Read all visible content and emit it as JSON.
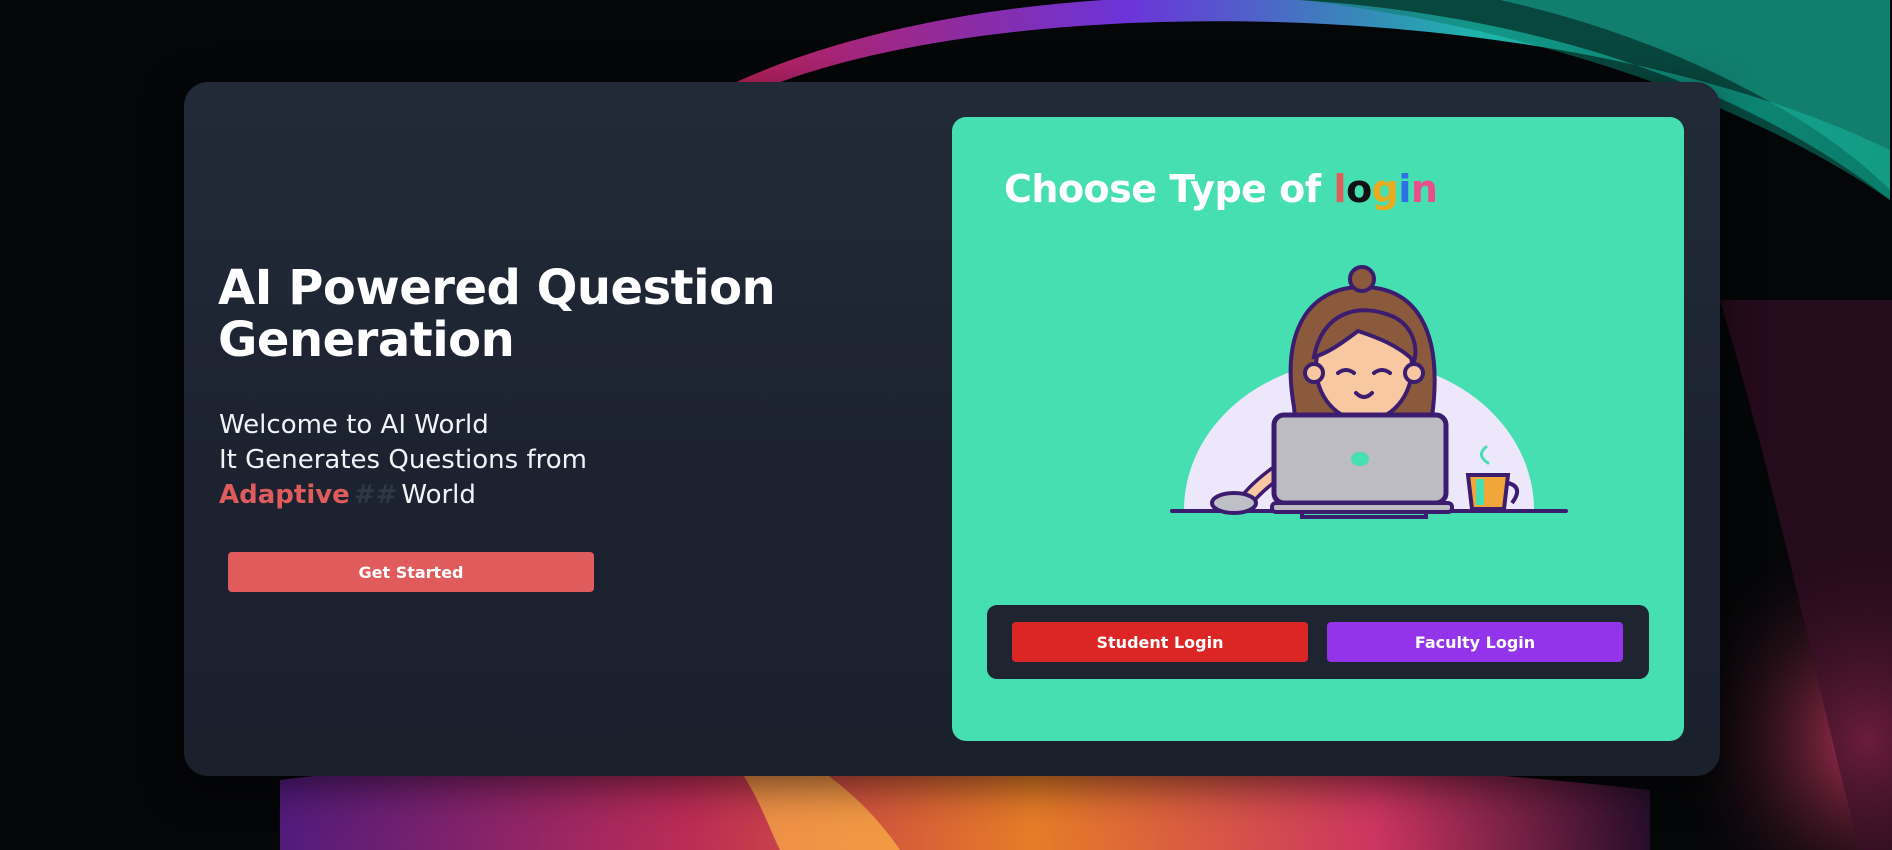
{
  "hero": {
    "title_line1": "AI Powered Question",
    "title_line2": "Generation",
    "welcome_line1": "Welcome to AI World",
    "welcome_line2": "It Generates Questions from",
    "welcome_adaptive": "Adaptive",
    "welcome_cursor": "##",
    "welcome_world": "World",
    "get_started_label": "Get Started"
  },
  "login": {
    "title_prefix": "Choose Type of ",
    "title_letters": [
      "l",
      "o",
      "g",
      "i",
      "n"
    ],
    "illustration": "woman-at-laptop-illustration",
    "student_label": "Student Login",
    "faculty_label": "Faculty Login"
  },
  "colors": {
    "page_background": "#050608",
    "card_background": "#1e2430",
    "panel_accent": "#45dfb1",
    "get_started": "#e05c5c",
    "student_button": "#dc2626",
    "faculty_button": "#9333ea",
    "title_letter_colors": [
      "#e15c5c",
      "#111111",
      "#e9ab1f",
      "#2f6ee3",
      "#ec4d8c"
    ]
  }
}
